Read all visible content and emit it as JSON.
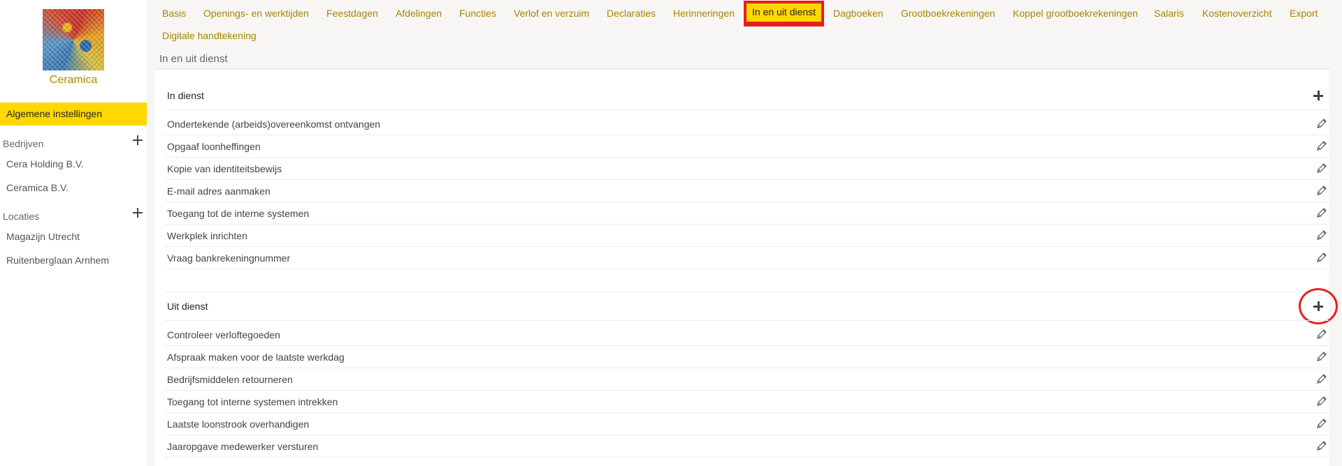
{
  "sidebar": {
    "company": "Ceramica",
    "active_item": "Algemene instellingen",
    "sections": [
      {
        "title": "Bedrijven",
        "items": [
          "Cera Holding B.V.",
          "Ceramica B.V."
        ]
      },
      {
        "title": "Locaties",
        "items": [
          "Magazijn Utrecht",
          "Ruitenberglaan Arnhem"
        ]
      }
    ]
  },
  "tabs": [
    "Basis",
    "Openings- en werktijden",
    "Feestdagen",
    "Afdelingen",
    "Functies",
    "Verlof en verzuim",
    "Declaraties",
    "Herinneringen",
    "In en uit dienst",
    "Dagboeken",
    "Grootboekrekeningen",
    "Koppel grootboekrekeningen",
    "Salaris",
    "Kostenoverzicht",
    "Export",
    "Digitale handtekening"
  ],
  "active_tab": "In en uit dienst",
  "breadcrumb": "In en uit dienst",
  "groups": [
    {
      "title": "In dienst",
      "items": [
        "Ondertekende (arbeids)overeenkomst ontvangen",
        "Opgaaf loonheffingen",
        "Kopie van identiteitsbewijs",
        "E-mail adres aanmaken",
        "Toegang tot de interne systemen",
        "Werkplek inrichten",
        "Vraag bankrekeningnummer"
      ]
    },
    {
      "title": "Uit dienst",
      "items": [
        "Controleer verloftegoeden",
        "Afspraak maken voor de laatste werkdag",
        "Bedrijfsmiddelen retourneren",
        "Toegang tot interne systemen intrekken",
        "Laatste loonstrook overhandigen",
        "Jaaropgave medewerker versturen"
      ]
    }
  ],
  "colors": {
    "accent": "#ffd800",
    "tab_text": "#a88400",
    "highlight": "#e8201a"
  },
  "icons": [
    "plus-icon",
    "pencil-icon"
  ]
}
